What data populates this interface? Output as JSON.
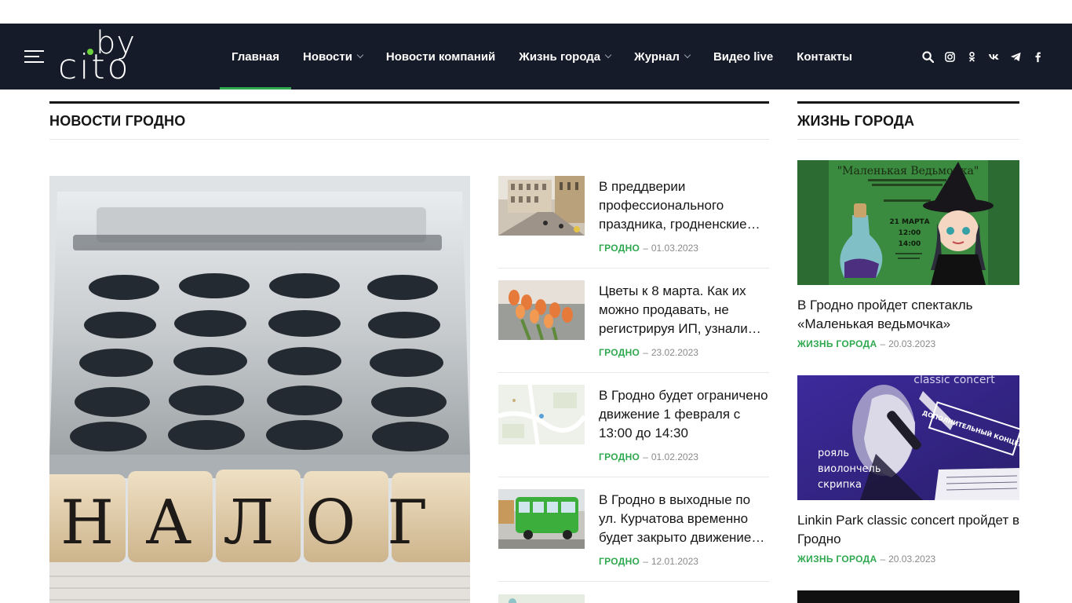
{
  "header": {
    "logo_by": "by",
    "logo_cito": "cito",
    "nav": [
      {
        "label": "Главная",
        "active": true,
        "dropdown": false
      },
      {
        "label": "Новости",
        "active": false,
        "dropdown": true
      },
      {
        "label": "Новости компаний",
        "active": false,
        "dropdown": false
      },
      {
        "label": "Жизнь города",
        "active": false,
        "dropdown": true
      },
      {
        "label": "Журнал",
        "active": false,
        "dropdown": true
      },
      {
        "label": "Видео live",
        "active": false,
        "dropdown": false
      },
      {
        "label": "Контакты",
        "active": false,
        "dropdown": false
      }
    ],
    "icons": [
      "search-icon",
      "instagram-icon",
      "odnoklassniki-icon",
      "vk-icon",
      "telegram-icon",
      "facebook-icon"
    ]
  },
  "main": {
    "section_title": "НОВОСТИ ГРОДНО",
    "featured_image_text": "НАЛОГ",
    "news": [
      {
        "title": "В преддверии профессионального праздника, гродненские…",
        "category": "ГРОДНО",
        "date": "01.03.2023"
      },
      {
        "title": "Цветы к 8 марта. Как их можно продавать, не регистрируя ИП, узнали…",
        "category": "ГРОДНО",
        "date": "23.02.2023"
      },
      {
        "title": "В Гродно будет ограничено движение 1 февраля с 13:00 до 14:30",
        "category": "ГРОДНО",
        "date": "01.02.2023"
      },
      {
        "title": "В Гродно в выходные по ул. Курчатова временно будет закрыто движение…",
        "category": "ГРОДНО",
        "date": "12.01.2023"
      }
    ]
  },
  "sidebar": {
    "section_title": "ЖИЗНЬ ГОРОДА",
    "items": [
      {
        "title": "В Гродно пройдет спектакль «Маленькая ведьмочка»",
        "category": "ЖИЗНЬ ГОРОДА",
        "date": "20.03.2023",
        "poster": {
          "heading": "\"Маленькая Ведьмочка\"",
          "date_line": "21 МАРТА",
          "time1": "12:00",
          "time2": "14:00"
        }
      },
      {
        "title": "Linkin Park classic concert пройдет в Гродно",
        "category": "ЖИЗНЬ ГОРОДА",
        "date": "20.03.2023",
        "poster": {
          "heading": "classic concert",
          "line1": "рояль",
          "line2": "виолончель",
          "line3": "скрипка",
          "stamp": "ДОПОЛНИТЕЛЬНЫЙ КОНЦЕРТ"
        }
      }
    ]
  },
  "colors": {
    "header_bg": "#151b28",
    "accent_green": "#2fa84f",
    "text": "#161616",
    "meta": "#8a8a8a"
  }
}
